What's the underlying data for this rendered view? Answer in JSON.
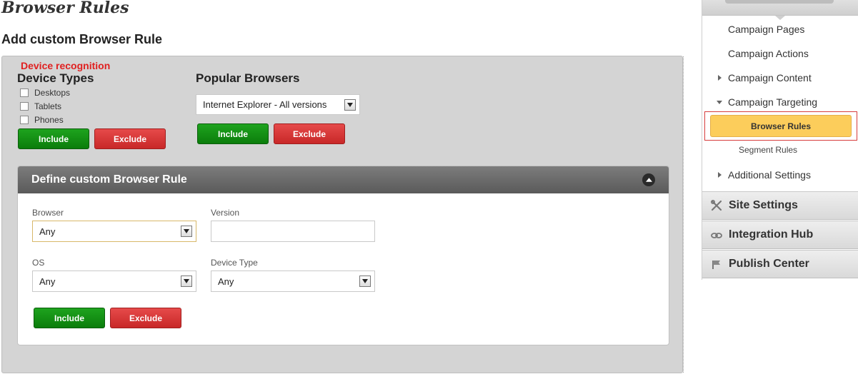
{
  "header": {
    "title": "Browser Rules",
    "subtitle": "Add custom Browser Rule"
  },
  "device_recognition": {
    "label": "Device recognition",
    "device_types": {
      "heading": "Device Types",
      "options": [
        "Desktops",
        "Tablets",
        "Phones"
      ],
      "include_label": "Include",
      "exclude_label": "Exclude"
    },
    "popular_browsers": {
      "heading": "Popular Browsers",
      "selected": "Internet Explorer - All versions",
      "include_label": "Include",
      "exclude_label": "Exclude"
    }
  },
  "custom_rule": {
    "title": "Define custom Browser Rule",
    "browser": {
      "label": "Browser",
      "value": "Any"
    },
    "version": {
      "label": "Version",
      "value": ""
    },
    "os": {
      "label": "OS",
      "value": "Any"
    },
    "device_type": {
      "label": "Device Type",
      "value": "Any"
    },
    "include_label": "Include",
    "exclude_label": "Exclude"
  },
  "sidebar": {
    "items": [
      {
        "label": "Campaign Pages"
      },
      {
        "label": "Campaign Actions"
      },
      {
        "label": "Campaign Content"
      },
      {
        "label": "Campaign Targeting"
      }
    ],
    "active_item": "Browser Rules",
    "sub_item": "Segment Rules",
    "additional": "Additional Settings",
    "sections": [
      {
        "label": "Site Settings",
        "icon": "tools-icon"
      },
      {
        "label": "Integration Hub",
        "icon": "link-icon"
      },
      {
        "label": "Publish Center",
        "icon": "flag-icon"
      }
    ]
  },
  "colors": {
    "include_green": "#0b7d0b",
    "exclude_red": "#c82828",
    "active_yellow": "#fccd5b",
    "label_red": "#e02020"
  }
}
